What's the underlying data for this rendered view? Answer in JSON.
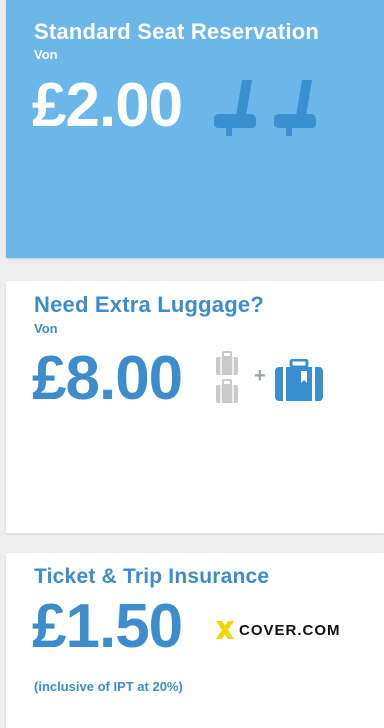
{
  "colors": {
    "seat_card_bg": "#6bb7ea",
    "accent_blue": "#3d8dcc",
    "seat_icon": "#3a8fd1",
    "luggage_small": "#c9c9c9",
    "luggage_large": "#3a8fd1",
    "cover_x": "#f5d400"
  },
  "seat_card": {
    "title": "Standard Seat Reservation",
    "from": "Von",
    "price": "£2.00",
    "icons": [
      "seat-icon",
      "seat-icon"
    ]
  },
  "luggage_card": {
    "title": "Need Extra Luggage?",
    "from": "Von",
    "price": "£8.00",
    "icons": [
      "small-luggage-icon",
      "small-luggage-icon",
      "plus-icon",
      "large-luggage-icon"
    ],
    "plus": "+"
  },
  "insurance_card": {
    "title": "Ticket & Trip Insurance",
    "price": "£1.50",
    "logo_text": "COVER.COM",
    "note": "(inclusive of IPT at 20%)"
  }
}
